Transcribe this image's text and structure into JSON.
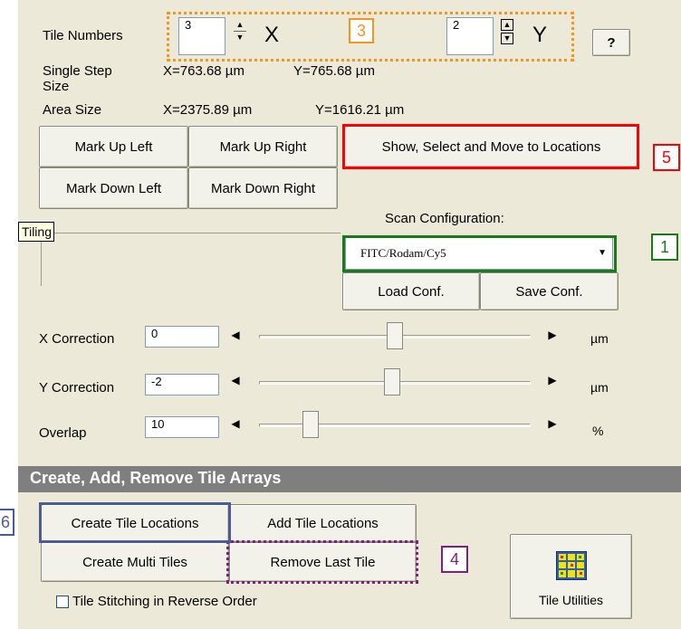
{
  "tile_numbers": {
    "label": "Tile Numbers",
    "x_value": "3",
    "x_axis": "X",
    "y_value": "2",
    "y_axis": "Y",
    "help_label": "?"
  },
  "step": {
    "label_line1": "Single Step",
    "label_line2": "Size",
    "x": "X=763.68 µm",
    "y": "Y=765.68 µm"
  },
  "area": {
    "label": "Area Size",
    "x": "X=2375.89 µm",
    "y": "Y=1616.21 µm"
  },
  "mark_buttons": {
    "up_left": "Mark Up Left",
    "up_right": "Mark Up Right",
    "down_left": "Mark Down Left",
    "down_right": "Mark Down Right"
  },
  "show_select_label": "Show, Select and Move to Locations",
  "tiling_group_label": "ne Tiling",
  "scan": {
    "label": "Scan Configuration:",
    "selected": "FITC/Rodam/Cy5",
    "load_label": "Load Conf.",
    "save_label": "Save Conf."
  },
  "corrections": [
    {
      "label": "X Correction",
      "value": "0",
      "unit": "µm",
      "level": 0.5
    },
    {
      "label": "Y Correction",
      "value": "-2",
      "unit": "µm",
      "level": 0.49
    },
    {
      "label": "Overlap",
      "value": "10",
      "unit": "%",
      "level": 0.17
    }
  ],
  "section_header": "Create, Add, Remove Tile Arrays",
  "tile_buttons": {
    "create_locations": "Create Tile Locations",
    "add_locations": "Add Tile Locations",
    "create_multi": "Create Multi Tiles",
    "remove_last": "Remove Last Tile"
  },
  "reverse_order": {
    "label": "Tile Stitching in Reverse Order",
    "checked": false
  },
  "tile_utilities_label": "Tile Utilities",
  "annotations": [
    {
      "number": "3",
      "color": "#f7941d"
    },
    {
      "number": "5",
      "color": "#ff0000"
    },
    {
      "number": "1",
      "color": "#1a7a1a"
    },
    {
      "number": "4",
      "color": "#7f1f7f"
    },
    {
      "number": "6",
      "color": "#4a5a9a"
    }
  ]
}
